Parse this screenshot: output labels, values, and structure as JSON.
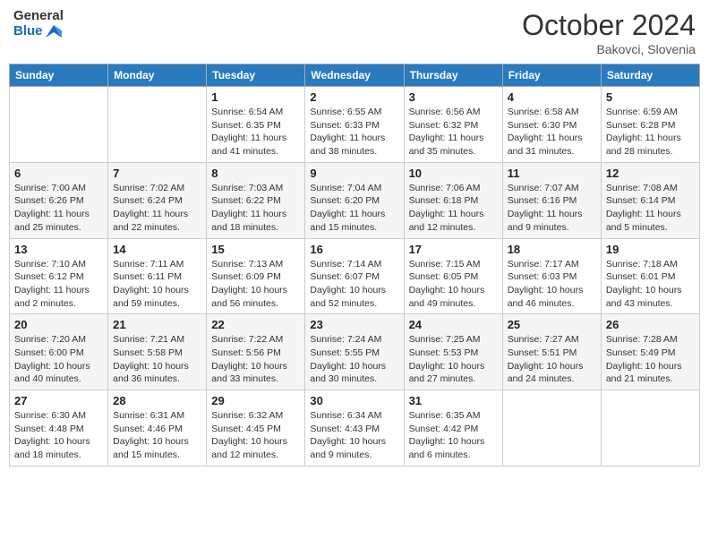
{
  "header": {
    "logo_line1": "General",
    "logo_line2": "Blue",
    "month_title": "October 2024",
    "location": "Bakovci, Slovenia"
  },
  "weekdays": [
    "Sunday",
    "Monday",
    "Tuesday",
    "Wednesday",
    "Thursday",
    "Friday",
    "Saturday"
  ],
  "weeks": [
    [
      null,
      null,
      {
        "day": "1",
        "sunrise": "Sunrise: 6:54 AM",
        "sunset": "Sunset: 6:35 PM",
        "daylight": "Daylight: 11 hours and 41 minutes."
      },
      {
        "day": "2",
        "sunrise": "Sunrise: 6:55 AM",
        "sunset": "Sunset: 6:33 PM",
        "daylight": "Daylight: 11 hours and 38 minutes."
      },
      {
        "day": "3",
        "sunrise": "Sunrise: 6:56 AM",
        "sunset": "Sunset: 6:32 PM",
        "daylight": "Daylight: 11 hours and 35 minutes."
      },
      {
        "day": "4",
        "sunrise": "Sunrise: 6:58 AM",
        "sunset": "Sunset: 6:30 PM",
        "daylight": "Daylight: 11 hours and 31 minutes."
      },
      {
        "day": "5",
        "sunrise": "Sunrise: 6:59 AM",
        "sunset": "Sunset: 6:28 PM",
        "daylight": "Daylight: 11 hours and 28 minutes."
      }
    ],
    [
      {
        "day": "6",
        "sunrise": "Sunrise: 7:00 AM",
        "sunset": "Sunset: 6:26 PM",
        "daylight": "Daylight: 11 hours and 25 minutes."
      },
      {
        "day": "7",
        "sunrise": "Sunrise: 7:02 AM",
        "sunset": "Sunset: 6:24 PM",
        "daylight": "Daylight: 11 hours and 22 minutes."
      },
      {
        "day": "8",
        "sunrise": "Sunrise: 7:03 AM",
        "sunset": "Sunset: 6:22 PM",
        "daylight": "Daylight: 11 hours and 18 minutes."
      },
      {
        "day": "9",
        "sunrise": "Sunrise: 7:04 AM",
        "sunset": "Sunset: 6:20 PM",
        "daylight": "Daylight: 11 hours and 15 minutes."
      },
      {
        "day": "10",
        "sunrise": "Sunrise: 7:06 AM",
        "sunset": "Sunset: 6:18 PM",
        "daylight": "Daylight: 11 hours and 12 minutes."
      },
      {
        "day": "11",
        "sunrise": "Sunrise: 7:07 AM",
        "sunset": "Sunset: 6:16 PM",
        "daylight": "Daylight: 11 hours and 9 minutes."
      },
      {
        "day": "12",
        "sunrise": "Sunrise: 7:08 AM",
        "sunset": "Sunset: 6:14 PM",
        "daylight": "Daylight: 11 hours and 5 minutes."
      }
    ],
    [
      {
        "day": "13",
        "sunrise": "Sunrise: 7:10 AM",
        "sunset": "Sunset: 6:12 PM",
        "daylight": "Daylight: 11 hours and 2 minutes."
      },
      {
        "day": "14",
        "sunrise": "Sunrise: 7:11 AM",
        "sunset": "Sunset: 6:11 PM",
        "daylight": "Daylight: 10 hours and 59 minutes."
      },
      {
        "day": "15",
        "sunrise": "Sunrise: 7:13 AM",
        "sunset": "Sunset: 6:09 PM",
        "daylight": "Daylight: 10 hours and 56 minutes."
      },
      {
        "day": "16",
        "sunrise": "Sunrise: 7:14 AM",
        "sunset": "Sunset: 6:07 PM",
        "daylight": "Daylight: 10 hours and 52 minutes."
      },
      {
        "day": "17",
        "sunrise": "Sunrise: 7:15 AM",
        "sunset": "Sunset: 6:05 PM",
        "daylight": "Daylight: 10 hours and 49 minutes."
      },
      {
        "day": "18",
        "sunrise": "Sunrise: 7:17 AM",
        "sunset": "Sunset: 6:03 PM",
        "daylight": "Daylight: 10 hours and 46 minutes."
      },
      {
        "day": "19",
        "sunrise": "Sunrise: 7:18 AM",
        "sunset": "Sunset: 6:01 PM",
        "daylight": "Daylight: 10 hours and 43 minutes."
      }
    ],
    [
      {
        "day": "20",
        "sunrise": "Sunrise: 7:20 AM",
        "sunset": "Sunset: 6:00 PM",
        "daylight": "Daylight: 10 hours and 40 minutes."
      },
      {
        "day": "21",
        "sunrise": "Sunrise: 7:21 AM",
        "sunset": "Sunset: 5:58 PM",
        "daylight": "Daylight: 10 hours and 36 minutes."
      },
      {
        "day": "22",
        "sunrise": "Sunrise: 7:22 AM",
        "sunset": "Sunset: 5:56 PM",
        "daylight": "Daylight: 10 hours and 33 minutes."
      },
      {
        "day": "23",
        "sunrise": "Sunrise: 7:24 AM",
        "sunset": "Sunset: 5:55 PM",
        "daylight": "Daylight: 10 hours and 30 minutes."
      },
      {
        "day": "24",
        "sunrise": "Sunrise: 7:25 AM",
        "sunset": "Sunset: 5:53 PM",
        "daylight": "Daylight: 10 hours and 27 minutes."
      },
      {
        "day": "25",
        "sunrise": "Sunrise: 7:27 AM",
        "sunset": "Sunset: 5:51 PM",
        "daylight": "Daylight: 10 hours and 24 minutes."
      },
      {
        "day": "26",
        "sunrise": "Sunrise: 7:28 AM",
        "sunset": "Sunset: 5:49 PM",
        "daylight": "Daylight: 10 hours and 21 minutes."
      }
    ],
    [
      {
        "day": "27",
        "sunrise": "Sunrise: 6:30 AM",
        "sunset": "Sunset: 4:48 PM",
        "daylight": "Daylight: 10 hours and 18 minutes."
      },
      {
        "day": "28",
        "sunrise": "Sunrise: 6:31 AM",
        "sunset": "Sunset: 4:46 PM",
        "daylight": "Daylight: 10 hours and 15 minutes."
      },
      {
        "day": "29",
        "sunrise": "Sunrise: 6:32 AM",
        "sunset": "Sunset: 4:45 PM",
        "daylight": "Daylight: 10 hours and 12 minutes."
      },
      {
        "day": "30",
        "sunrise": "Sunrise: 6:34 AM",
        "sunset": "Sunset: 4:43 PM",
        "daylight": "Daylight: 10 hours and 9 minutes."
      },
      {
        "day": "31",
        "sunrise": "Sunrise: 6:35 AM",
        "sunset": "Sunset: 4:42 PM",
        "daylight": "Daylight: 10 hours and 6 minutes."
      },
      null,
      null
    ]
  ]
}
